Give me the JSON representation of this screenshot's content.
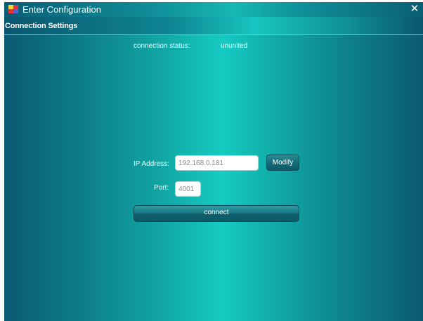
{
  "window": {
    "title": "Enter Configuration",
    "close_symbol": "✕"
  },
  "section": {
    "title": "Connection Settings"
  },
  "status": {
    "label": "connection status:",
    "value": "ununited"
  },
  "form": {
    "ip_label": "IP Address:",
    "ip_value": "192.168.0.181",
    "port_label": "Port:",
    "port_value": "4001",
    "modify_label": "Modify",
    "connect_label": "connect"
  },
  "colors": {
    "teal_center": "#15cbc2",
    "teal_edge": "#0b5a72",
    "button": "#166d79"
  },
  "icons": [
    "app-icon",
    "close-icon"
  ]
}
